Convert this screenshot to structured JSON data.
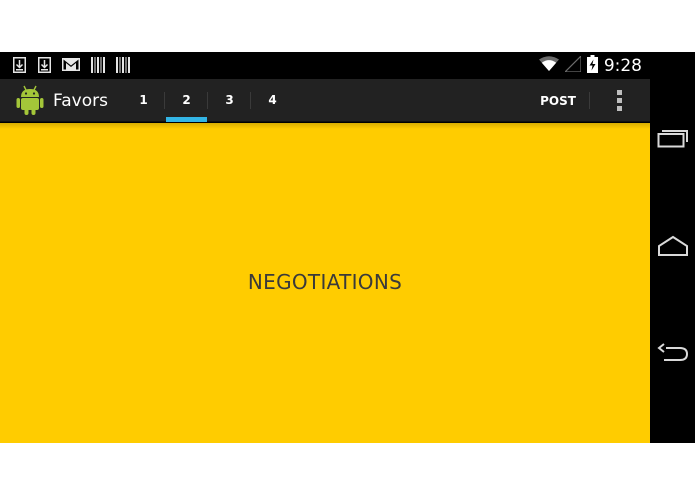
{
  "status_bar": {
    "notification_icons": [
      "download-icon",
      "download-icon",
      "gmail-icon",
      "barcode-icon",
      "barcode-icon"
    ],
    "system_icons": [
      "wifi-icon",
      "signal-icon",
      "battery-charging-icon"
    ],
    "time": "9:28"
  },
  "action_bar": {
    "app_icon": "android-icon",
    "title": "Favors",
    "tabs": [
      {
        "label": "1",
        "active": false
      },
      {
        "label": "2",
        "active": true
      },
      {
        "label": "3",
        "active": false
      },
      {
        "label": "4",
        "active": false
      }
    ],
    "post_label": "POST",
    "overflow_icon": "overflow-menu-icon"
  },
  "content": {
    "label": "NEGOTIATIONS",
    "background_color": "#ffcc00"
  },
  "colors": {
    "accent": "#33b5e5",
    "action_bar": "#222222"
  },
  "nav_bar": {
    "buttons": [
      "recent-apps-icon",
      "home-icon",
      "back-icon"
    ]
  }
}
